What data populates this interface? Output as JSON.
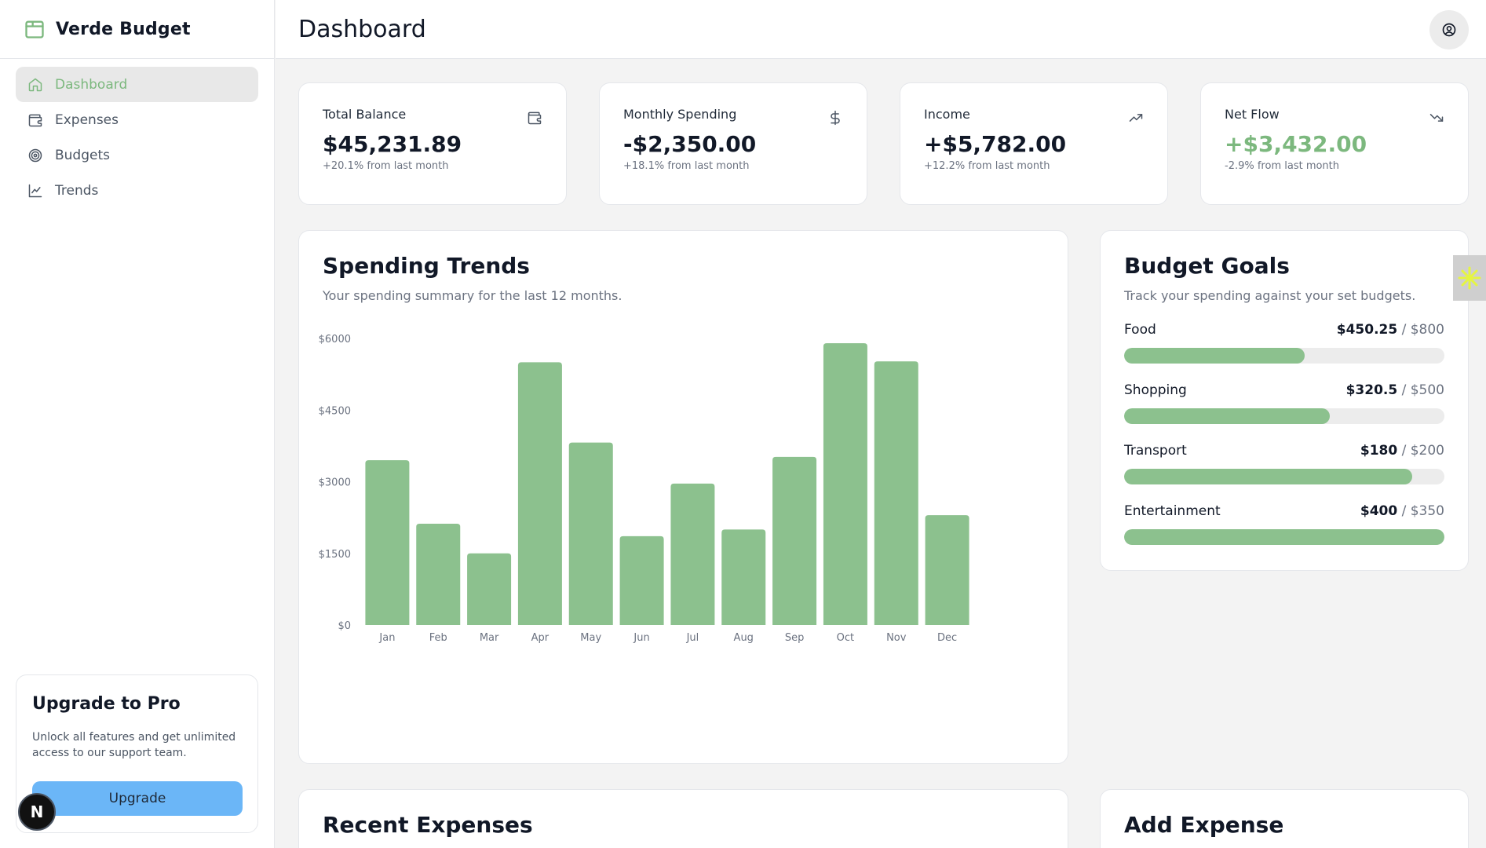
{
  "app": {
    "name": "Verde Budget"
  },
  "sidebar": {
    "items": [
      {
        "label": "Dashboard",
        "icon": "home-icon",
        "active": true
      },
      {
        "label": "Expenses",
        "icon": "wallet-icon",
        "active": false
      },
      {
        "label": "Budgets",
        "icon": "target-icon",
        "active": false
      },
      {
        "label": "Trends",
        "icon": "line-chart-icon",
        "active": false
      }
    ],
    "upgrade": {
      "title": "Upgrade to Pro",
      "description": "Unlock all features and get unlimited access to our support team.",
      "button": "Upgrade"
    },
    "badge": "N"
  },
  "header": {
    "title": "Dashboard"
  },
  "stats": [
    {
      "label": "Total Balance",
      "value": "$45,231.89",
      "sub": "+20.1% from last month",
      "icon": "wallet-icon"
    },
    {
      "label": "Monthly Spending",
      "value": "-$2,350.00",
      "sub": "+18.1% from last month",
      "icon": "dollar-icon"
    },
    {
      "label": "Income",
      "value": "+$5,782.00",
      "sub": "+12.2% from last month",
      "icon": "trending-up-icon"
    },
    {
      "label": "Net Flow",
      "value": "+$3,432.00",
      "sub": "-2.9% from last month",
      "icon": "trending-down-icon"
    }
  ],
  "trends": {
    "title": "Spending Trends",
    "subtitle": "Your spending summary for the last 12 months."
  },
  "chart_data": {
    "type": "bar",
    "categories": [
      "Jan",
      "Feb",
      "Mar",
      "Apr",
      "May",
      "Jun",
      "Jul",
      "Aug",
      "Sep",
      "Oct",
      "Nov",
      "Dec"
    ],
    "values": [
      3450,
      2120,
      1500,
      5500,
      3820,
      1860,
      2960,
      2000,
      3520,
      5900,
      5520,
      2300
    ],
    "ylim": [
      0,
      6000
    ],
    "yticks": [
      "$0",
      "$1500",
      "$3000",
      "$4500",
      "$6000"
    ],
    "ytick_values": [
      0,
      1500,
      3000,
      4500,
      6000
    ],
    "grid": false,
    "color": "#8cc18e"
  },
  "goals": {
    "title": "Budget Goals",
    "subtitle": "Track your spending against your set budgets.",
    "items": [
      {
        "name": "Food",
        "spent": "$450.25",
        "limit": " / $800",
        "fraction": 0.563
      },
      {
        "name": "Shopping",
        "spent": "$320.5",
        "limit": " / $500",
        "fraction": 0.641
      },
      {
        "name": "Transport",
        "spent": "$180",
        "limit": " / $200",
        "fraction": 0.9
      },
      {
        "name": "Entertainment",
        "spent": "$400",
        "limit": " / $350",
        "fraction": 1.0
      }
    ]
  },
  "recent": {
    "title": "Recent Expenses"
  },
  "add_expense": {
    "title": "Add Expense"
  },
  "colors": {
    "accent": "#7cb87e",
    "bar": "#8cc18e",
    "upgrade": "#6bb6f7"
  }
}
